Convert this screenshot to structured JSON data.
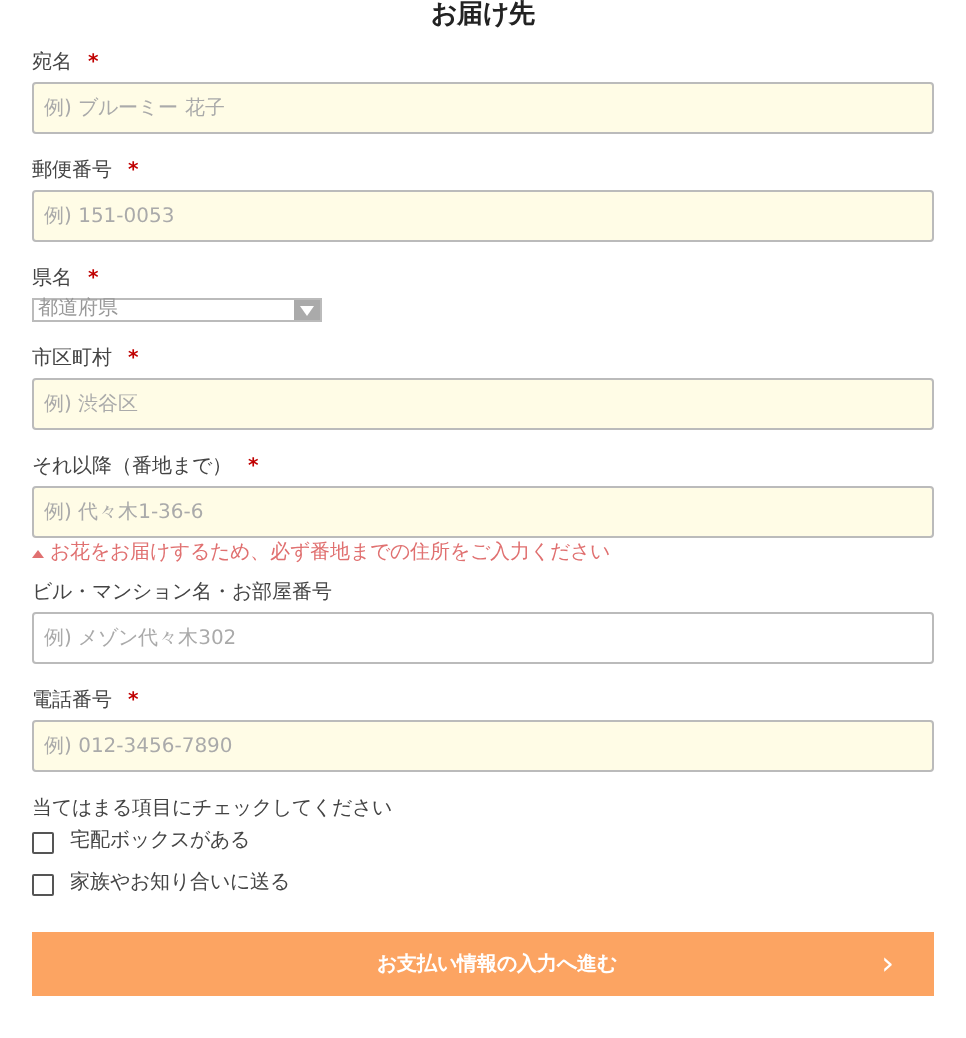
{
  "title": "お届け先",
  "fields": [
    {
      "kind": "text",
      "label": "宛名",
      "required_mark": "*",
      "placeholder": "例) ブルーミー 花子",
      "highlighted": true
    },
    {
      "kind": "text",
      "label": "郵便番号",
      "required_mark": "*",
      "placeholder": "例) 151-0053",
      "highlighted": true
    },
    {
      "kind": "select",
      "label": "県名",
      "required_mark": "*",
      "value": "都道府県"
    },
    {
      "kind": "text",
      "label": "市区町村",
      "required_mark": "*",
      "placeholder": "例) 渋谷区",
      "highlighted": true
    },
    {
      "kind": "text",
      "label": "それ以降（番地まで）",
      "required_mark": "*",
      "placeholder": "例) 代々木1-36-6",
      "highlighted": true,
      "note": "お花をお届けするため、必ず番地までの住所をご入力ください"
    },
    {
      "kind": "text",
      "label": "ビル・マンション名・お部屋番号",
      "placeholder": "例) メゾン代々木302",
      "highlighted": false
    },
    {
      "kind": "text",
      "label": "電話番号",
      "required_mark": "*",
      "placeholder": "例) 012-3456-7890",
      "highlighted": true
    }
  ],
  "checks_heading": "当てはまる項目にチェックしてください",
  "checks": [
    {
      "label": "宅配ボックスがある",
      "checked": false
    },
    {
      "label": "家族やお知り合いに送る",
      "checked": false
    }
  ],
  "submit": {
    "label": "お支払い情報の入力へ進む",
    "icon": "›"
  }
}
